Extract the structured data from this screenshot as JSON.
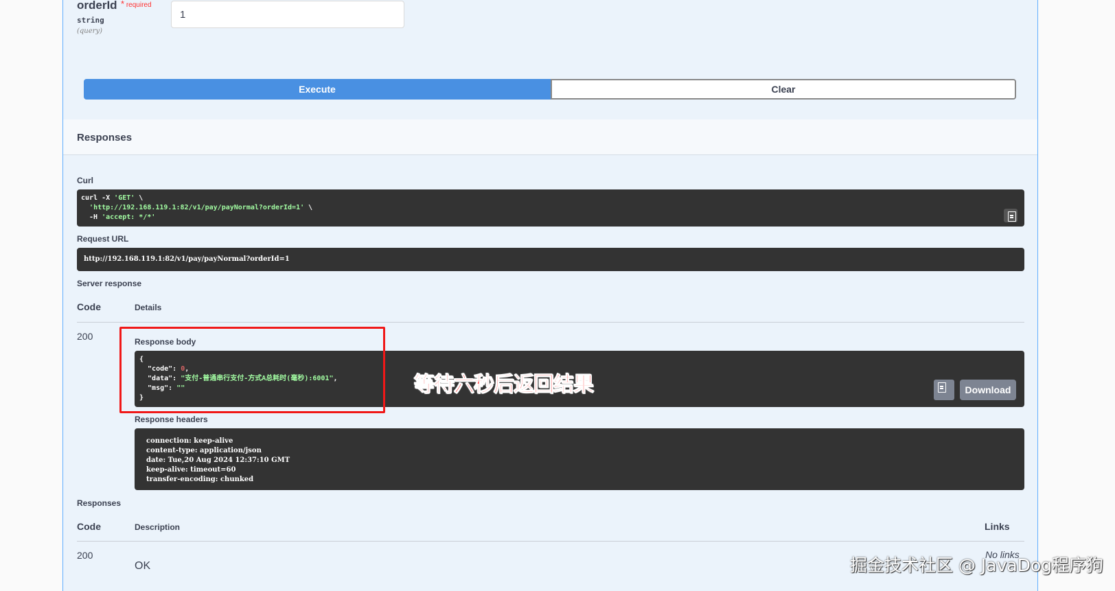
{
  "parameter": {
    "name": "orderId",
    "required_mark": "*",
    "required_label": "required",
    "type": "string",
    "location": "(query)",
    "value": "1"
  },
  "actions": {
    "execute_label": "Execute",
    "clear_label": "Clear"
  },
  "responses_section": {
    "title": "Responses"
  },
  "curl": {
    "label": "Curl",
    "line1_a": "curl -X ",
    "line1_method": "'GET'",
    "line1_b": " \\",
    "line2_url": "'http://192.168.119.1:82/v1/pay/payNormal?orderId=1'",
    "line2_b": " \\",
    "line3_a": "  -H ",
    "line3_header": "'accept: */*'"
  },
  "request_url": {
    "label": "Request URL",
    "value": "http://192.168.119.1:82/v1/pay/payNormal?orderId=1"
  },
  "server_response": {
    "label": "Server response",
    "col_code": "Code",
    "col_details": "Details",
    "code": "200",
    "body_label": "Response body",
    "body": {
      "open": "{",
      "code_key": "  \"code\": ",
      "code_val": "0",
      "code_comma": ",",
      "data_key": "  \"data\": ",
      "data_val": "\"支付-普通串行支付-方式A总耗时(毫秒):6001\"",
      "data_comma": ",",
      "msg_key": "  \"msg\": ",
      "msg_val": "\"\"",
      "close": "}"
    },
    "download_label": "Download",
    "headers_label": "Response headers",
    "headers": [
      "connection: keep-alive",
      "content-type: application/json",
      "date: Tue,20 Aug 2024 12:37:10 GMT",
      "keep-alive: timeout=60",
      "transfer-encoding: chunked"
    ]
  },
  "annotation": "等待六秒后返回结果",
  "responses": {
    "label": "Responses",
    "col_code": "Code",
    "col_description": "Description",
    "col_links": "Links",
    "rows": [
      {
        "code": "200",
        "description": "OK",
        "links": "No links"
      }
    ]
  },
  "watermark": "掘金技术社区 @ JavaDog程序狗",
  "colors": {
    "execute_bg": "#4990e2",
    "panel_bg": "#ebf3fb",
    "code_bg": "#333333",
    "highlight": "#f01818"
  }
}
